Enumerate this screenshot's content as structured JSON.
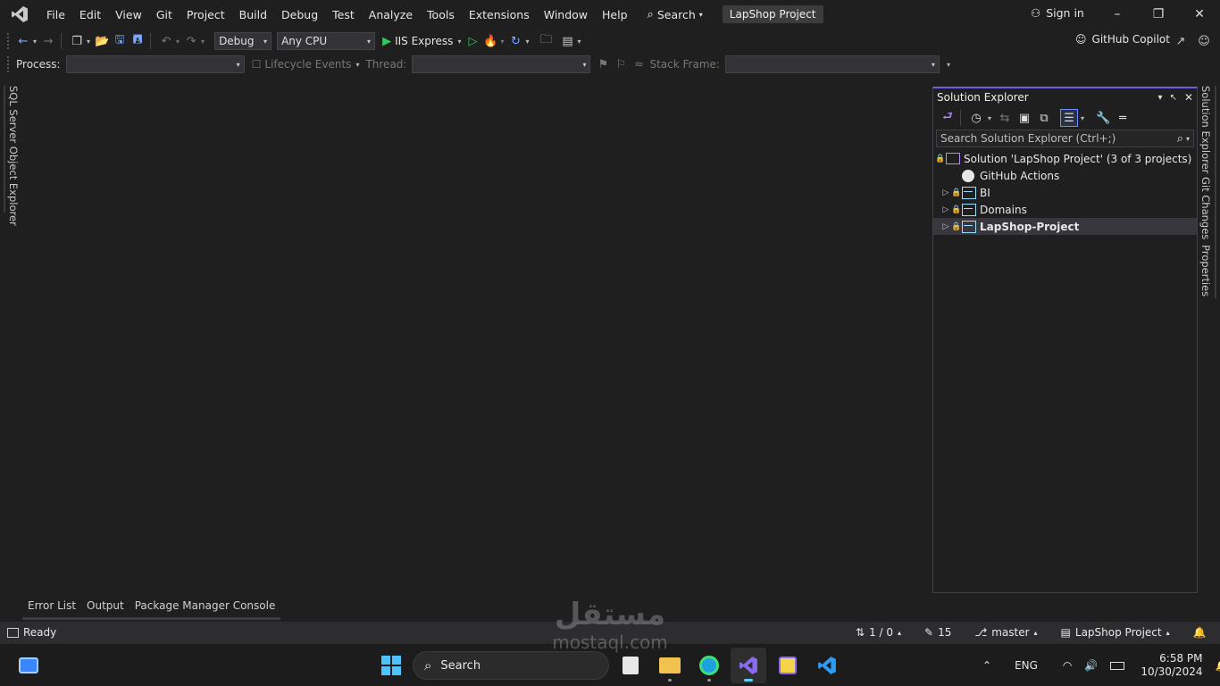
{
  "titlebar": {
    "menus": [
      "File",
      "Edit",
      "View",
      "Git",
      "Project",
      "Build",
      "Debug",
      "Test",
      "Analyze",
      "Tools",
      "Extensions",
      "Window",
      "Help"
    ],
    "search_label": "Search",
    "project_name": "LapShop Project",
    "sign_in": "Sign in"
  },
  "toolbar": {
    "config": "Debug",
    "platform": "Any CPU",
    "run_target": "IIS Express",
    "copilot": "GitHub Copilot"
  },
  "debug_toolbar": {
    "process_label": "Process:",
    "lifecycle_label": "Lifecycle Events",
    "thread_label": "Thread:",
    "stack_label": "Stack Frame:"
  },
  "left_tab": {
    "label": "SQL Server Object Explorer"
  },
  "solution_explorer": {
    "title": "Solution Explorer",
    "search_placeholder": "Search Solution Explorer (Ctrl+;)",
    "solution_label": "Solution 'LapShop Project' (3 of 3 projects)",
    "items": [
      {
        "label": "GitHub Actions"
      },
      {
        "label": "BI"
      },
      {
        "label": "Domains"
      },
      {
        "label": "LapShop-Project"
      }
    ]
  },
  "right_tabs": {
    "solution": "Solution Explorer",
    "git": "Git Changes",
    "properties": "Properties"
  },
  "bottom_tabs": [
    "Error List",
    "Output",
    "Package Manager Console"
  ],
  "status": {
    "ready": "Ready",
    "sync": "1 / 0",
    "edits": "15",
    "branch": "master",
    "repo": "LapShop Project"
  },
  "taskbar": {
    "search_label": "Search",
    "lang": "ENG",
    "time": "6:58 PM",
    "date": "10/30/2024"
  },
  "watermark": {
    "arabic": "مستقل",
    "latin": "mostaql.com"
  },
  "colors": {
    "accent": "#6b5ee8",
    "vs_purple": "#8a6cf0",
    "run_green": "#32c75b"
  }
}
